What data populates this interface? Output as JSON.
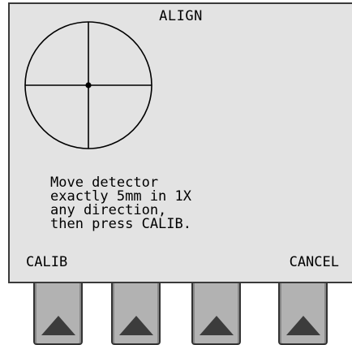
{
  "screen": {
    "title": "ALIGN",
    "instructions": [
      "Move detector",
      "exactly 5mm in 1X",
      "any direction,",
      "then press CALIB."
    ],
    "softkeys": {
      "left_label": "CALIB",
      "right_label": "CANCEL"
    }
  },
  "hardware_keys": [
    {
      "icon": "up-triangle-icon"
    },
    {
      "icon": "up-triangle-icon"
    },
    {
      "icon": "up-triangle-icon"
    },
    {
      "icon": "up-triangle-icon"
    }
  ],
  "colors": {
    "screen_bg": "#e3e3e3",
    "key_bg": "#b2b2b2",
    "key_arrow": "#3c3c3c"
  }
}
